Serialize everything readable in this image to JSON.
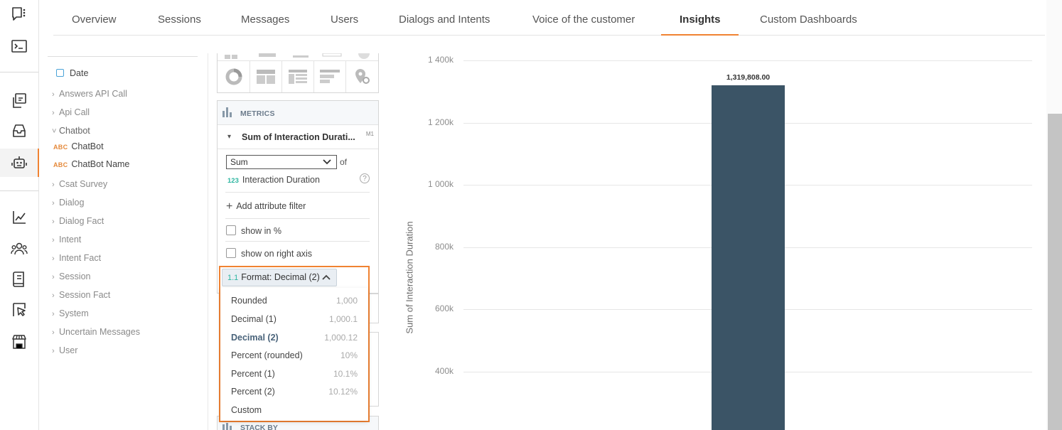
{
  "nav": {
    "tabs": [
      {
        "label": "Overview"
      },
      {
        "label": "Sessions"
      },
      {
        "label": "Messages"
      },
      {
        "label": "Users"
      },
      {
        "label": "Dialogs and Intents"
      },
      {
        "label": "Voice of the customer"
      },
      {
        "label": "Insights"
      },
      {
        "label": "Custom Dashboards"
      }
    ],
    "active_tab": "Insights"
  },
  "rail": {
    "icons": [
      "chat-dots-icon",
      "terminal-icon",
      "conversation-icon",
      "inbox-icon",
      "robot-icon",
      "line-chart-icon",
      "users-icon",
      "book-icon",
      "cursor-select-icon",
      "store-icon"
    ],
    "active_icon": "robot-icon",
    "accent": "#f08232"
  },
  "catalog": {
    "date_label": "Date",
    "groups": [
      {
        "label": "Answers API Call"
      },
      {
        "label": "Api Call"
      },
      {
        "label": "Chatbot"
      },
      {
        "label": "Csat Survey"
      },
      {
        "label": "Dialog"
      },
      {
        "label": "Dialog Fact"
      },
      {
        "label": "Intent"
      },
      {
        "label": "Intent Fact"
      },
      {
        "label": "Session"
      },
      {
        "label": "Session Fact"
      },
      {
        "label": "System"
      },
      {
        "label": "Uncertain Messages"
      },
      {
        "label": "User"
      }
    ],
    "chatbot_children": [
      {
        "type": "ABC",
        "label": "ChatBot"
      },
      {
        "type": "ABC",
        "label": "ChatBot Name"
      }
    ]
  },
  "metrics": {
    "header": "METRICS",
    "metric_title": "Sum of Interaction Durati...",
    "metric_id": "M1",
    "aggregation": "Sum",
    "of_label": "of",
    "attribute_type": "123",
    "attribute": "Interaction Duration",
    "add_filter": "Add attribute filter",
    "show_percent": "show in %",
    "show_right_axis": "show on right axis",
    "format_icon": "1.1",
    "format_button": "Format: Decimal (2)",
    "format_options": [
      {
        "label": "Rounded",
        "example": "1,000"
      },
      {
        "label": "Decimal (1)",
        "example": "1,000.1"
      },
      {
        "label": "Decimal (2)",
        "example": "1,000.12"
      },
      {
        "label": "Percent (rounded)",
        "example": "10%"
      },
      {
        "label": "Percent (1)",
        "example": "10.1%"
      },
      {
        "label": "Percent (2)",
        "example": "10.12%"
      },
      {
        "label": "Custom",
        "example": ""
      }
    ],
    "selected_format": "Decimal (2)"
  },
  "stack_by": {
    "header": "STACK BY"
  },
  "chart_data": {
    "type": "bar",
    "title": "",
    "xlabel": "",
    "ylabel": "Sum of Interaction Duration",
    "categories": [
      ""
    ],
    "values": [
      1319808.0
    ],
    "value_labels": [
      "1,319,808.00"
    ],
    "yticks": [
      "1 400k",
      "1 200k",
      "1 000k",
      "800k",
      "600k",
      "400k"
    ],
    "ytick_values": [
      1400000,
      1200000,
      1000000,
      800000,
      600000,
      400000
    ],
    "ylim_visible": [
      260000,
      1400000
    ],
    "bar_color": "#3b5466",
    "grid": true
  }
}
